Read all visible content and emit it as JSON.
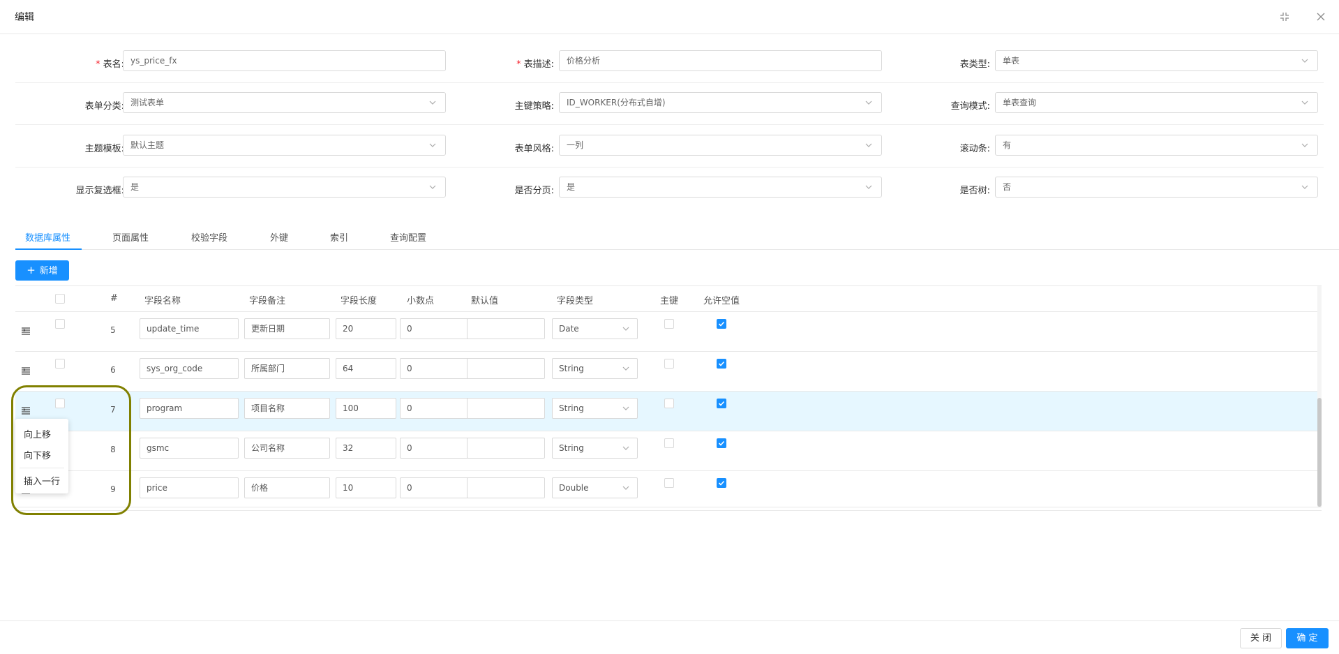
{
  "dialog": {
    "title": "编辑"
  },
  "form": {
    "rows": [
      [
        {
          "label": "表名:",
          "required": true,
          "value": "ys_price_fx",
          "type": "input"
        },
        {
          "label": "表描述:",
          "required": true,
          "value": "价格分析",
          "type": "input"
        },
        {
          "label": "表类型:",
          "required": false,
          "value": "单表",
          "type": "select"
        }
      ],
      [
        {
          "label": "表单分类:",
          "required": false,
          "value": "测试表单",
          "type": "select"
        },
        {
          "label": "主键策略:",
          "required": false,
          "value": "ID_WORKER(分布式自增)",
          "type": "select"
        },
        {
          "label": "查询模式:",
          "required": false,
          "value": "单表查询",
          "type": "select"
        }
      ],
      [
        {
          "label": "主题模板:",
          "required": false,
          "value": "默认主题",
          "type": "select"
        },
        {
          "label": "表单风格:",
          "required": false,
          "value": "一列",
          "type": "select"
        },
        {
          "label": "滚动条:",
          "required": false,
          "value": "有",
          "type": "select"
        }
      ],
      [
        {
          "label": "显示复选框:",
          "required": false,
          "value": "是",
          "type": "select"
        },
        {
          "label": "是否分页:",
          "required": false,
          "value": "是",
          "type": "select"
        },
        {
          "label": "是否树:",
          "required": false,
          "value": "否",
          "type": "select"
        }
      ]
    ],
    "required_mark": "*"
  },
  "tabs": [
    "数据库属性",
    "页面属性",
    "校验字段",
    "外键",
    "索引",
    "查询配置"
  ],
  "active_tab": 0,
  "add_button": {
    "label": "新增",
    "icon": "plus-icon"
  },
  "table": {
    "headers": {
      "num": "#",
      "name": "字段名称",
      "remark": "字段备注",
      "length": "字段长度",
      "decimal": "小数点",
      "default": "默认值",
      "type": "字段类型",
      "pk": "主键",
      "nullable": "允许空值"
    },
    "rows": [
      {
        "num": "5",
        "name": "update_time",
        "remark": "更新日期",
        "length": "20",
        "decimal": "0",
        "default": "",
        "type": "Date",
        "pk": false,
        "nullable": true,
        "highlighted": false
      },
      {
        "num": "6",
        "name": "sys_org_code",
        "remark": "所属部门",
        "length": "64",
        "decimal": "0",
        "default": "",
        "type": "String",
        "pk": false,
        "nullable": true,
        "highlighted": false
      },
      {
        "num": "7",
        "name": "program",
        "remark": "项目名称",
        "length": "100",
        "decimal": "0",
        "default": "",
        "type": "String",
        "pk": false,
        "nullable": true,
        "highlighted": true
      },
      {
        "num": "8",
        "name": "gsmc",
        "remark": "公司名称",
        "length": "32",
        "decimal": "0",
        "default": "",
        "type": "String",
        "pk": false,
        "nullable": true,
        "highlighted": false
      },
      {
        "num": "9",
        "name": "price",
        "remark": "价格",
        "length": "10",
        "decimal": "0",
        "default": "",
        "type": "Double",
        "pk": false,
        "nullable": true,
        "highlighted": false
      }
    ]
  },
  "context_menu": {
    "items": [
      "向上移",
      "向下移",
      "插入一行"
    ]
  },
  "footer": {
    "close_label": "关 闭",
    "ok_label": "确 定"
  },
  "colors": {
    "primary": "#1890ff",
    "required": "#f5222d",
    "highlight_row": "#e6f7ff",
    "annotation_ring": "#808000"
  },
  "icons": {
    "minimize": "compress-icon",
    "close": "close-icon",
    "drag": "drag-handle-icon",
    "select": "chevron-down-icon"
  }
}
